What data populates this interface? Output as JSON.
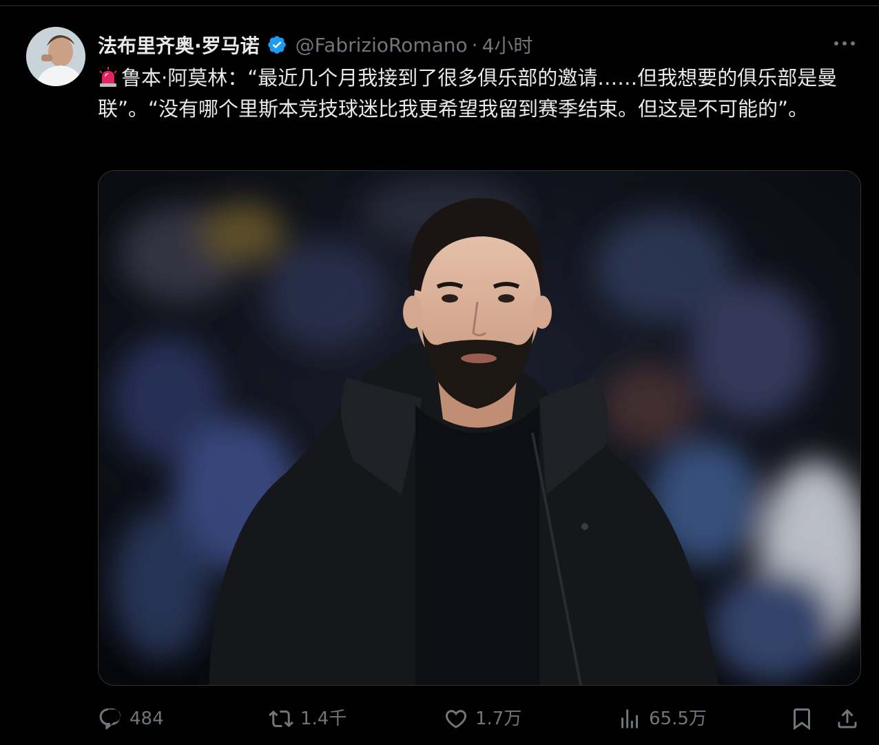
{
  "author": {
    "display_name": "法布里齐奥·罗马诺",
    "handle": "@FabrizioRomano",
    "separator": "·",
    "time": "4小时",
    "verified": true
  },
  "tweet": {
    "text": "鲁本·阿莫林：“最近几个月我接到了很多俱乐部的邀请……但我想要的俱乐部是曼联”。“没有哪个里斯本竞技球迷比我更希望我留到赛季结束。但这是不可能的”。"
  },
  "icons": {
    "more": "more-icon",
    "verified": "verified-badge-icon",
    "siren": "rotating-light-icon",
    "reply": "reply-icon",
    "retweet": "retweet-icon",
    "like": "heart-icon",
    "views": "views-icon",
    "bookmark": "bookmark-icon",
    "share": "share-icon"
  },
  "stats": {
    "replies": "484",
    "retweets": "1.4千",
    "likes": "1.7万",
    "views": "65.5万"
  },
  "colors": {
    "background": "#000000",
    "text": "#e7e9ea",
    "secondary": "#71767b",
    "verified": "#1d9bf0"
  }
}
